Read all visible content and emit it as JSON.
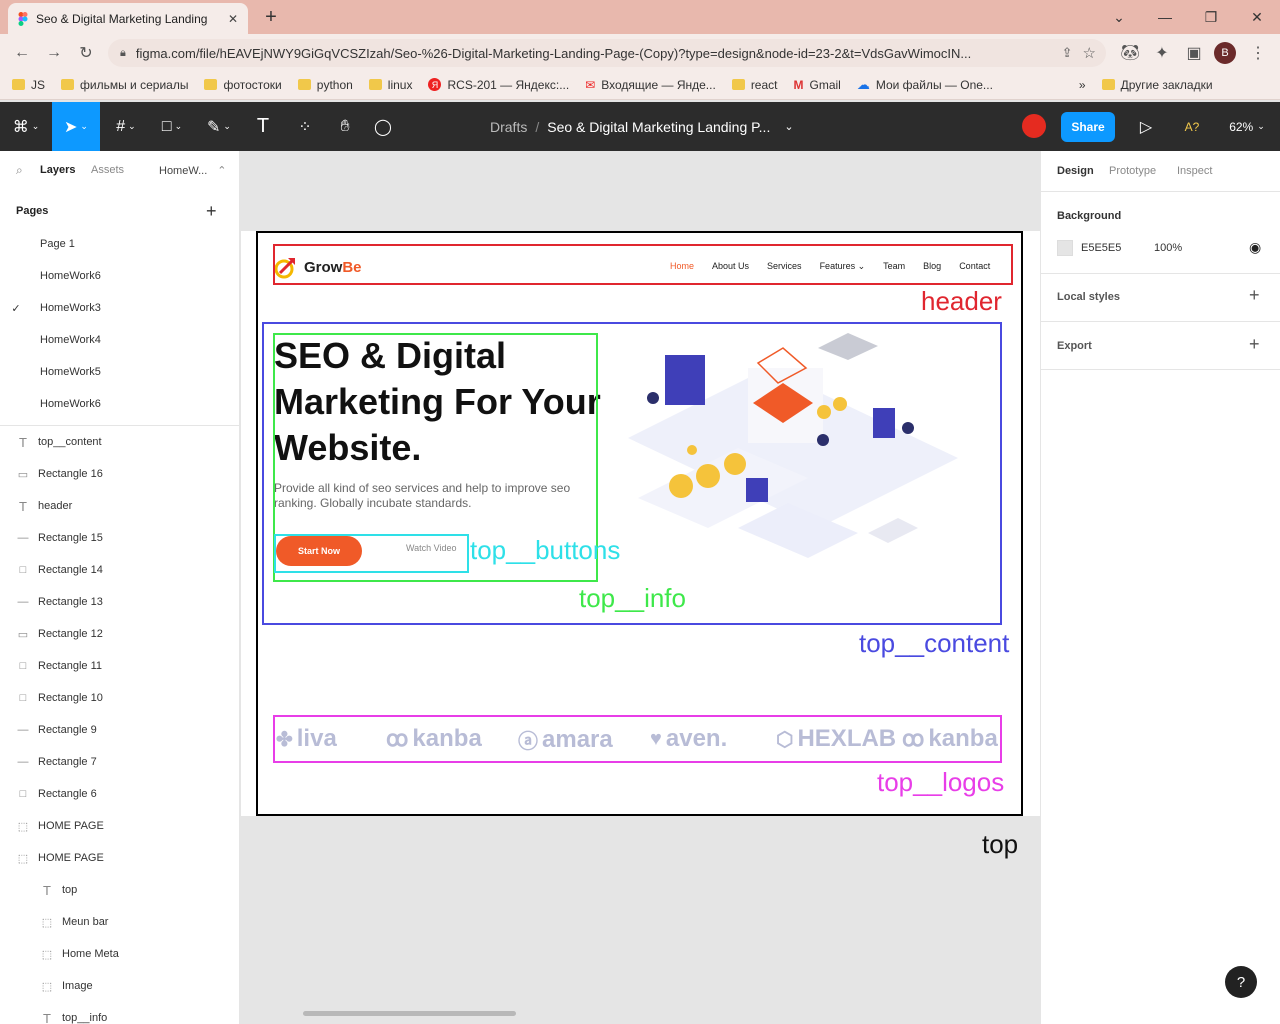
{
  "browser": {
    "tab_title": "Seo & Digital Marketing Landing",
    "url": "figma.com/file/hEAVEjNWY9GiGqVCSZIzah/Seo-%26-Digital-Marketing-Landing-Page-(Copy)?type=design&node-id=23-2&t=VdsGavWimocIN...",
    "profile_initial": "B",
    "bookmarks": [
      "JS",
      "фильмы и сериалы",
      "фотостоки",
      "python",
      "linux",
      "RCS-201 — Яндекс:...",
      "Входящие — Янде...",
      "react",
      "Gmail",
      "Мои файлы — One..."
    ],
    "more_bookmarks": "»",
    "other_bookmarks": "Другие закладки"
  },
  "figma": {
    "breadcrumb_root": "Drafts",
    "breadcrumb_sep": "/",
    "file_name": "Seo & Digital Marketing Landing P...",
    "share_label": "Share",
    "accessibility_label": "A?",
    "zoom": "62%",
    "left_tabs": {
      "layers": "Layers",
      "assets": "Assets",
      "page": "HomeW..."
    },
    "pages_header": "Pages",
    "pages": [
      "Page 1",
      "HomeWork6",
      "HomeWork3",
      "HomeWork4",
      "HomeWork5",
      "HomeWork6"
    ],
    "current_page_index": 2,
    "layers": [
      {
        "name": "top__content",
        "type": "text"
      },
      {
        "name": "Rectangle 16",
        "type": "rect-thin"
      },
      {
        "name": "header",
        "type": "text"
      },
      {
        "name": "Rectangle 15",
        "type": "line"
      },
      {
        "name": "Rectangle 14",
        "type": "rect"
      },
      {
        "name": "Rectangle 13",
        "type": "line"
      },
      {
        "name": "Rectangle 12",
        "type": "rect-thin"
      },
      {
        "name": "Rectangle 11",
        "type": "rect"
      },
      {
        "name": "Rectangle 10",
        "type": "rect"
      },
      {
        "name": "Rectangle 9",
        "type": "line"
      },
      {
        "name": "Rectangle 7",
        "type": "line"
      },
      {
        "name": "Rectangle 6",
        "type": "rect"
      },
      {
        "name": "HOME PAGE",
        "type": "frame"
      },
      {
        "name": "HOME PAGE",
        "type": "frame"
      },
      {
        "name": "top",
        "type": "text",
        "indent": 1
      },
      {
        "name": "Meun bar",
        "type": "frame",
        "indent": 1
      },
      {
        "name": "Home Meta",
        "type": "frame",
        "indent": 1
      },
      {
        "name": "Image",
        "type": "frame",
        "indent": 1
      },
      {
        "name": "top__info",
        "type": "text",
        "indent": 1
      }
    ],
    "right_tabs": {
      "design": "Design",
      "prototype": "Prototype",
      "inspect": "Inspect"
    },
    "background_label": "Background",
    "background_hex": "E5E5E5",
    "background_opacity": "100%",
    "local_styles": "Local styles",
    "export": "Export",
    "help": "?"
  },
  "canvas": {
    "site": {
      "logo_text_a": "Grow",
      "logo_text_b": "Be",
      "nav": [
        "Home",
        "About Us",
        "Services",
        "Features",
        "Team",
        "Blog",
        "Contact"
      ],
      "hero_title": "SEO & Digital Marketing For Your Website.",
      "hero_text": "Provide all kind of seo services and help to improve seo ranking. Globally incubate standards.",
      "btn_start": "Start Now",
      "btn_watch": "Watch Video",
      "logos": [
        "liva",
        "kanba",
        "amara",
        "aven.",
        "HEXLAB",
        "kanba"
      ]
    },
    "annotations": {
      "header": "header",
      "top_content": "top__content",
      "top_info": "top__info",
      "top_buttons": "top__buttons",
      "top_logos": "top__logos",
      "top": "top"
    },
    "colors": {
      "header": "#e0262f",
      "top_content": "#4a4ae0",
      "top_info": "#3ee84a",
      "top_buttons": "#2ee0e8",
      "top_logos": "#e83ee8",
      "accent": "#f05a28"
    }
  }
}
